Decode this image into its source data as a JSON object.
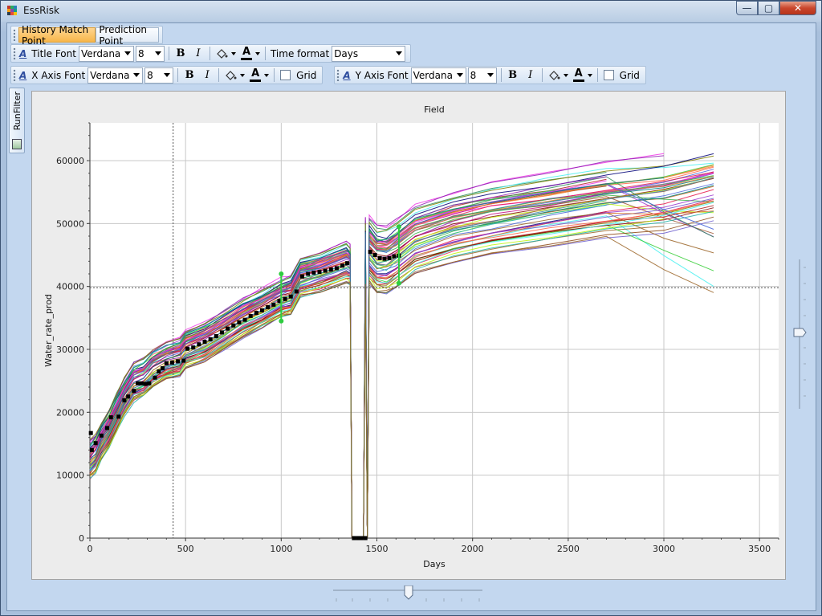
{
  "window": {
    "title": "EssRisk",
    "buttons": {
      "minimize": "—",
      "maximize": "▢",
      "close": "✕"
    }
  },
  "tabs": [
    {
      "label": "History Match Point",
      "active": true
    },
    {
      "label": "Prediction Point",
      "active": false
    }
  ],
  "toolbar": {
    "title_font": {
      "label": "Title Font",
      "font": "Verdana",
      "size": "8"
    },
    "time_format": {
      "label": "Time format",
      "value": "Days"
    },
    "x_axis_font": {
      "label": "X Axis Font",
      "font": "Verdana",
      "size": "8",
      "grid_label": "Grid"
    },
    "y_axis_font": {
      "label": "Y Axis Font",
      "font": "Verdana",
      "size": "8",
      "grid_label": "Grid"
    },
    "bold": "B",
    "italic": "I",
    "font_icon": "A"
  },
  "sidebar": {
    "label": "RunFilter"
  },
  "colors": {
    "accent_tab": "#f7b64a",
    "history_points": "#000000",
    "error_bars": "#2ecc40",
    "plot_bg": "#ffffff"
  },
  "chart_data": {
    "type": "line",
    "title": "Field",
    "xlabel": "Days",
    "ylabel": "Water_rate_prod",
    "xlim": [
      0,
      3600
    ],
    "ylim": [
      0,
      66000
    ],
    "x_ticks": [
      0,
      500,
      1000,
      1500,
      2000,
      2500,
      3000,
      3500
    ],
    "y_ticks": [
      0,
      10000,
      20000,
      30000,
      40000,
      50000,
      60000
    ],
    "grid": true,
    "crosshair": {
      "x": 435,
      "y": 39800
    },
    "ensemble": {
      "count": 60,
      "base_curve": [
        [
          0,
          12500
        ],
        [
          30,
          13500
        ],
        [
          60,
          15500
        ],
        [
          100,
          17500
        ],
        [
          140,
          20000
        ],
        [
          180,
          22500
        ],
        [
          230,
          24800
        ],
        [
          280,
          25500
        ],
        [
          330,
          27000
        ],
        [
          400,
          28200
        ],
        [
          470,
          28800
        ],
        [
          500,
          30000
        ],
        [
          600,
          31200
        ],
        [
          700,
          33000
        ],
        [
          800,
          35000
        ],
        [
          900,
          36500
        ],
        [
          1000,
          38200
        ],
        [
          1050,
          38600
        ],
        [
          1100,
          41500
        ],
        [
          1200,
          42300
        ],
        [
          1340,
          43800
        ],
        [
          1360,
          43500
        ],
        [
          1370,
          0
        ],
        [
          1430,
          0
        ],
        [
          1440,
          45500
        ],
        [
          1450,
          0
        ],
        [
          1460,
          45800
        ],
        [
          1500,
          44300
        ],
        [
          1550,
          44200
        ],
        [
          1600,
          45200
        ],
        [
          1700,
          47500
        ],
        [
          1900,
          49500
        ],
        [
          2100,
          50800
        ],
        [
          2400,
          52300
        ],
        [
          2700,
          53800
        ],
        [
          3000,
          55000
        ],
        [
          3260,
          56800
        ]
      ],
      "spread_early": 3000,
      "spread_late": 5000
    },
    "history_points": [
      [
        5,
        16700
      ],
      [
        10,
        14000
      ],
      [
        30,
        15100
      ],
      [
        60,
        16300
      ],
      [
        90,
        17500
      ],
      [
        110,
        19200
      ],
      [
        150,
        19300
      ],
      [
        180,
        21900
      ],
      [
        200,
        22500
      ],
      [
        230,
        23400
      ],
      [
        250,
        24600
      ],
      [
        270,
        24600
      ],
      [
        290,
        24500
      ],
      [
        310,
        24600
      ],
      [
        340,
        25500
      ],
      [
        360,
        26500
      ],
      [
        380,
        27000
      ],
      [
        400,
        27800
      ],
      [
        430,
        27900
      ],
      [
        460,
        28100
      ],
      [
        490,
        28200
      ],
      [
        510,
        30100
      ],
      [
        540,
        30300
      ],
      [
        570,
        30800
      ],
      [
        600,
        31200
      ],
      [
        630,
        31600
      ],
      [
        660,
        32100
      ],
      [
        690,
        32700
      ],
      [
        720,
        33300
      ],
      [
        750,
        33800
      ],
      [
        780,
        34300
      ],
      [
        810,
        34700
      ],
      [
        840,
        35300
      ],
      [
        870,
        35800
      ],
      [
        900,
        36200
      ],
      [
        930,
        36700
      ],
      [
        960,
        37100
      ],
      [
        990,
        37700
      ],
      [
        1020,
        38000
      ],
      [
        1050,
        38400
      ],
      [
        1080,
        39200
      ],
      [
        1110,
        41600
      ],
      [
        1140,
        42000
      ],
      [
        1170,
        42200
      ],
      [
        1200,
        42300
      ],
      [
        1230,
        42500
      ],
      [
        1260,
        42700
      ],
      [
        1290,
        42900
      ],
      [
        1320,
        43300
      ],
      [
        1345,
        43700
      ],
      [
        1380,
        0
      ],
      [
        1400,
        0
      ],
      [
        1420,
        0
      ],
      [
        1440,
        0
      ],
      [
        1465,
        45500
      ],
      [
        1490,
        45000
      ],
      [
        1515,
        44500
      ],
      [
        1540,
        44400
      ],
      [
        1565,
        44500
      ],
      [
        1590,
        44800
      ],
      [
        1615,
        44900
      ]
    ],
    "error_bars": [
      {
        "x": 1000,
        "low": 34500,
        "high": 42000
      },
      {
        "x": 1615,
        "low": 40500,
        "high": 49500
      }
    ]
  }
}
